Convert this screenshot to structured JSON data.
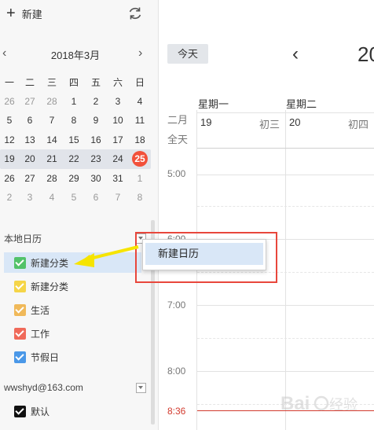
{
  "sidebar": {
    "new_label": "新建",
    "mini_calendar": {
      "title": "2018年3月",
      "weekdays": [
        "一",
        "二",
        "三",
        "四",
        "五",
        "六",
        "日"
      ],
      "rows": [
        [
          "26",
          "27",
          "28",
          "1",
          "2",
          "3",
          "4"
        ],
        [
          "5",
          "6",
          "7",
          "8",
          "9",
          "10",
          "11"
        ],
        [
          "12",
          "13",
          "14",
          "15",
          "16",
          "17",
          "18"
        ],
        [
          "19",
          "20",
          "21",
          "22",
          "23",
          "24",
          "25"
        ],
        [
          "26",
          "27",
          "28",
          "29",
          "30",
          "31",
          "1"
        ],
        [
          "2",
          "3",
          "4",
          "5",
          "6",
          "7",
          "8"
        ]
      ],
      "today": "25"
    },
    "local_section": "本地日历",
    "categories": [
      {
        "label": "新建分类",
        "color": "#52c26a"
      },
      {
        "label": "新建分类",
        "color": "#f5d548"
      },
      {
        "label": "生活",
        "color": "#f0b95a"
      },
      {
        "label": "工作",
        "color": "#f06a5a"
      },
      {
        "label": "节假日",
        "color": "#4a98e8"
      }
    ],
    "account_section": "wwshyd@163.com",
    "account_categories": [
      {
        "label": "默认",
        "color": "#111111"
      }
    ]
  },
  "main": {
    "today_button": "今天",
    "year_partial": "20",
    "weekdays": [
      "星期一",
      "星期二"
    ],
    "month_label": "二月",
    "allday_label": "全天",
    "days": [
      {
        "num": "19",
        "lunar": "初三"
      },
      {
        "num": "20",
        "lunar": "初四"
      }
    ],
    "times": [
      "5:00",
      "6:00",
      "7:00",
      "8:00"
    ],
    "now_time": "8:36"
  },
  "popup": {
    "item": "新建日历"
  },
  "watermark": "Bai 经验",
  "colors": {
    "today": "#f2503a",
    "highlight": "#e8473c",
    "selection": "#d9e7f7"
  }
}
